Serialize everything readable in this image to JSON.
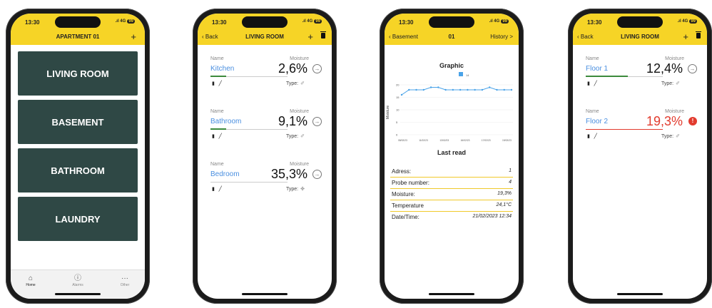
{
  "status": {
    "time": "13:30",
    "signal": ".ıl 4G",
    "battery": "99"
  },
  "screen1": {
    "title": "APARTMENT 01",
    "plus": "+",
    "rooms": [
      "LIVING ROOM",
      "BASEMENT",
      "BATHROOM",
      "LAUNDRY"
    ],
    "tabs": [
      {
        "icon": "home-icon",
        "glyph": "⌂",
        "label": "Home"
      },
      {
        "icon": "alarm-icon",
        "glyph": "ⓘ",
        "label": "Alarms"
      },
      {
        "icon": "more-icon",
        "glyph": "···",
        "label": "Other"
      }
    ]
  },
  "screen2": {
    "back": "Back",
    "title": "LIVING ROOM",
    "plus": "+",
    "name_label": "Name",
    "moisture_label": "Moisture",
    "type_label": "Type:",
    "sensors": [
      {
        "name": "Kitchen",
        "value": "2,6%",
        "fill": 0.2
      },
      {
        "name": "Bathroom",
        "value": "9,1%",
        "fill": 0.2
      },
      {
        "name": "Bedroom",
        "value": "35,3%",
        "fill": 0
      }
    ]
  },
  "screen3": {
    "back": "Basement",
    "title": "01",
    "history": "History >",
    "graphic_title": "Graphic",
    "legend": "14",
    "ylabel": "Moisture",
    "last_read": "Last read",
    "info": [
      {
        "k": "Adress:",
        "v": "1"
      },
      {
        "k": "Probe number:",
        "v": "4"
      },
      {
        "k": "Moisture:",
        "v": "19,3%"
      },
      {
        "k": "Temperature",
        "v": "24,1°C"
      },
      {
        "k": "Date/Time:",
        "v": "21/02/2023 12:34"
      }
    ]
  },
  "screen4": {
    "back": "Back",
    "title": "LIVING ROOM",
    "plus": "+",
    "name_label": "Name",
    "moisture_label": "Moisture",
    "type_label": "Type:",
    "sensors": [
      {
        "name": "Floor 1",
        "value": "12,4%",
        "fill": 0.55,
        "alert": false
      },
      {
        "name": "Floor 2",
        "value": "19,3%",
        "fill": 1,
        "alert": true
      }
    ]
  },
  "chart_data": {
    "type": "line",
    "series": [
      {
        "name": "14",
        "values": [
          16,
          18,
          18,
          18,
          19,
          19,
          18,
          18,
          18,
          18,
          18,
          18,
          19,
          18,
          18,
          18
        ]
      }
    ],
    "yticks": [
      "0",
      "5",
      "10",
      "15",
      "20"
    ],
    "xticks": [
      "08/02/23",
      "11/02/23",
      "13/02/23",
      "16/02/23",
      "17/02/23",
      "19/02/23"
    ],
    "ylim": [
      0,
      20
    ],
    "colors": {
      "line": "#4aa3e8"
    }
  }
}
